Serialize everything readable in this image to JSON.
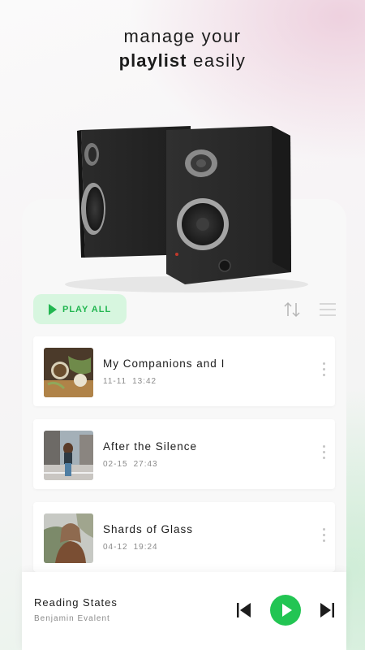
{
  "headline": {
    "line1": "manage your",
    "line2_bold": "playlist",
    "line2_rest": "easily"
  },
  "toolbar": {
    "play_all_label": "PLAY ALL"
  },
  "songs": [
    {
      "title": "My Companions and I",
      "date": "11-11",
      "time": "13:42"
    },
    {
      "title": "After the Silence",
      "date": "02-15",
      "time": "27:43"
    },
    {
      "title": "Shards of Glass",
      "date": "04-12",
      "time": "19:24"
    }
  ],
  "now_playing": {
    "title": "Reading States",
    "artist": "Benjamin Evalent"
  },
  "colors": {
    "accent": "#22c553",
    "play_all_bg": "#d7f6df",
    "text": "#1c1c1c",
    "muted": "#8a8a8a"
  },
  "icons": {
    "play_all": "play-icon",
    "sort": "sort-arrows-icon",
    "menu": "menu-lines-icon",
    "more": "more-vertical-icon",
    "prev": "skip-previous-icon",
    "play": "play-icon",
    "next": "skip-next-icon"
  }
}
